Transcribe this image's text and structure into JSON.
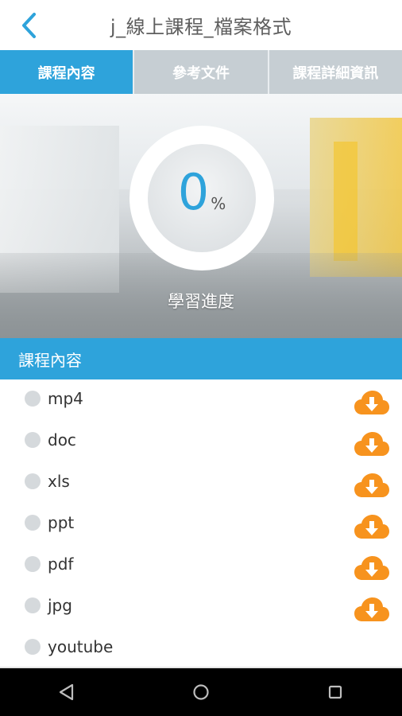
{
  "header": {
    "title": "j_線上課程_檔案格式",
    "back_icon": "chevron-left-icon",
    "accent_color": "#2ea3db"
  },
  "tabs": [
    {
      "label": "課程內容",
      "active": true
    },
    {
      "label": "參考文件",
      "active": false
    },
    {
      "label": "課程詳細資訊",
      "active": false
    }
  ],
  "progress": {
    "value": "0",
    "unit": "%",
    "label": "學習進度"
  },
  "section": {
    "title": "課程內容"
  },
  "items": [
    {
      "label": "mp4",
      "download": true
    },
    {
      "label": "doc",
      "download": true
    },
    {
      "label": "xls",
      "download": true
    },
    {
      "label": "ppt",
      "download": true
    },
    {
      "label": "pdf",
      "download": true
    },
    {
      "label": "jpg",
      "download": true
    },
    {
      "label": "youtube",
      "download": false
    }
  ],
  "colors": {
    "tab_active": "#2ea3db",
    "tab_inactive": "#c6ced3",
    "download": "#f7931e"
  },
  "navbar": {
    "icons": [
      "back-triangle-icon",
      "home-circle-icon",
      "recents-square-icon"
    ]
  }
}
